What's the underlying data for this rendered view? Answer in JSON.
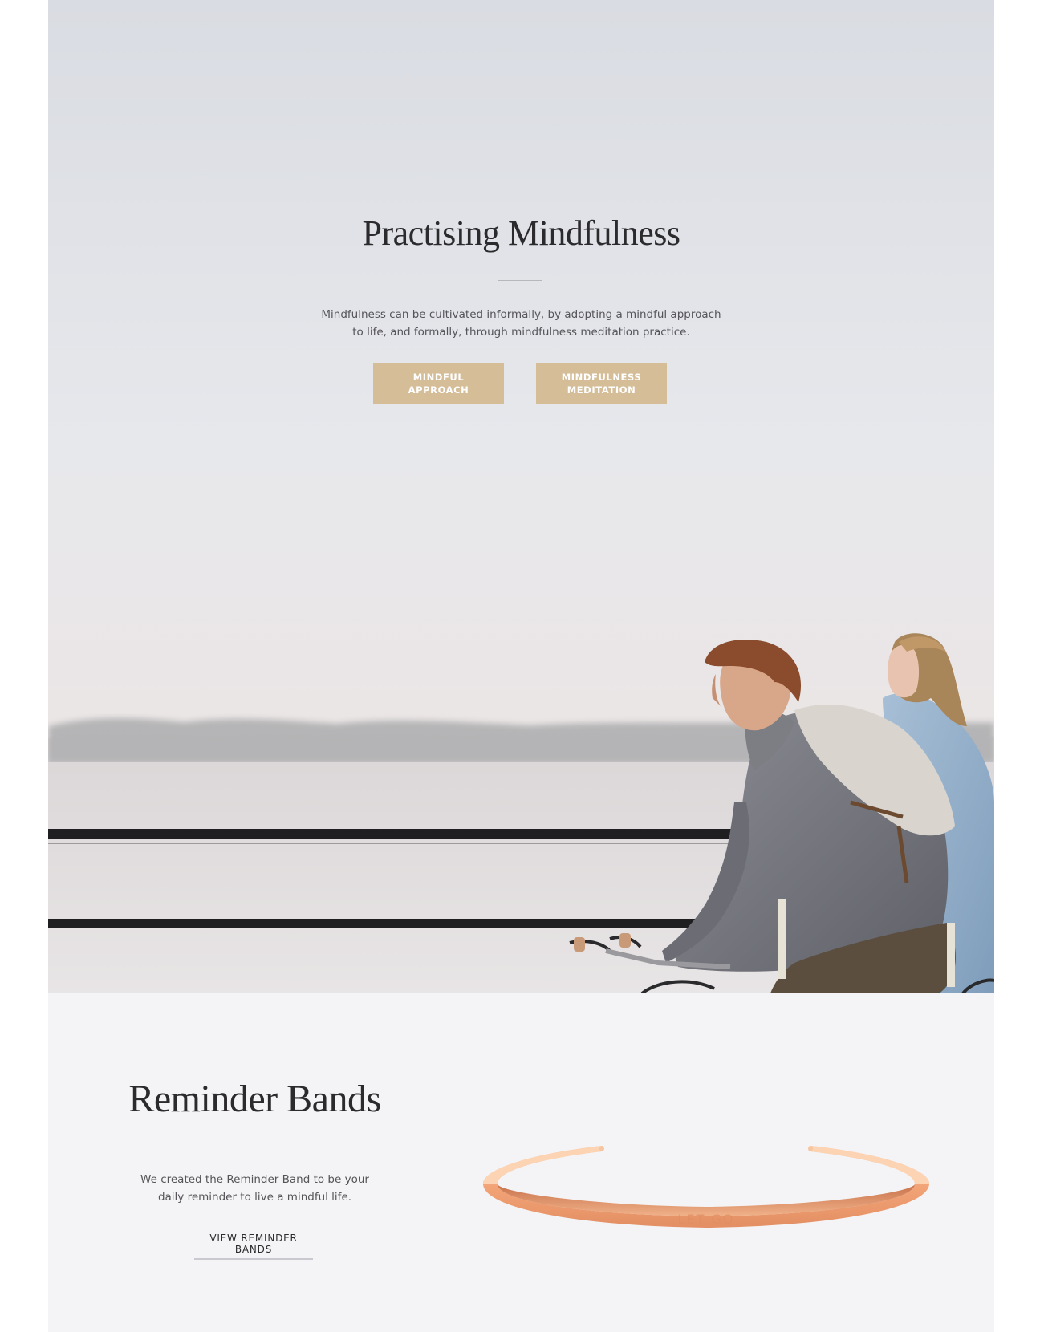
{
  "hero": {
    "title": "Practising Mindfulness",
    "description_lines": [
      "Mindfulness can be cultivated informally, by adopting a mindful approach",
      "to life, and formally, through mindfulness meditation practice."
    ],
    "buttons": [
      {
        "lines": [
          "MINDFUL",
          "APPROACH"
        ]
      },
      {
        "lines": [
          "MINDFULNESS",
          "MEDITATION"
        ]
      }
    ],
    "accent_color": "#d5bd98"
  },
  "bands": {
    "title": "Reminder Bands",
    "description_lines": [
      "We created the Reminder Band to be your",
      "daily reminder to live a mindful life."
    ],
    "link_label": "VIEW REMINDER BANDS",
    "band_engraving": "LET GO",
    "band_color": "#f2a477"
  }
}
